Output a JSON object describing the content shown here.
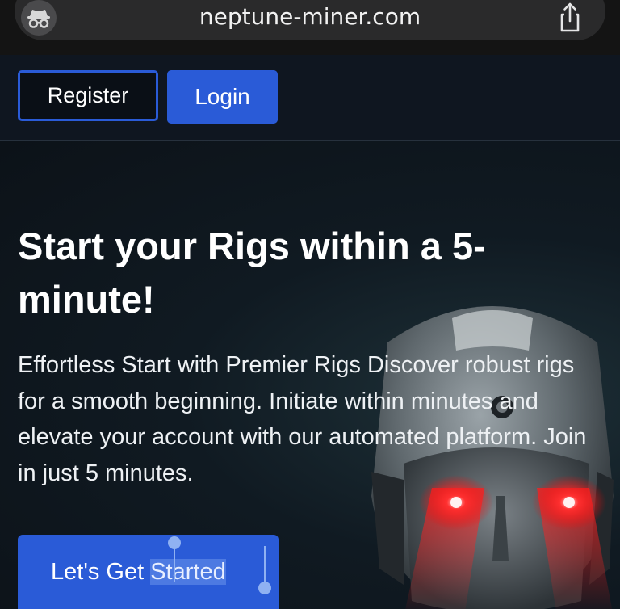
{
  "browser": {
    "url": "neptune-miner.com",
    "incognito_icon": "incognito-icon",
    "share_icon": "share-icon"
  },
  "header": {
    "register_label": "Register",
    "login_label": "Login"
  },
  "hero": {
    "title": "Start your Rigs within a 5-minute!",
    "description": "Effortless Start with Premier Rigs Discover robust rigs for a smooth beginning. Initiate within minutes and elevate your account with our automated platform. Join in just 5 minutes.",
    "cta_prefix": "Let's Get ",
    "cta_selected": "Started"
  },
  "colors": {
    "accent": "#2a5bd7",
    "background": "#0d1219",
    "robot_eyes": "#e02020"
  }
}
